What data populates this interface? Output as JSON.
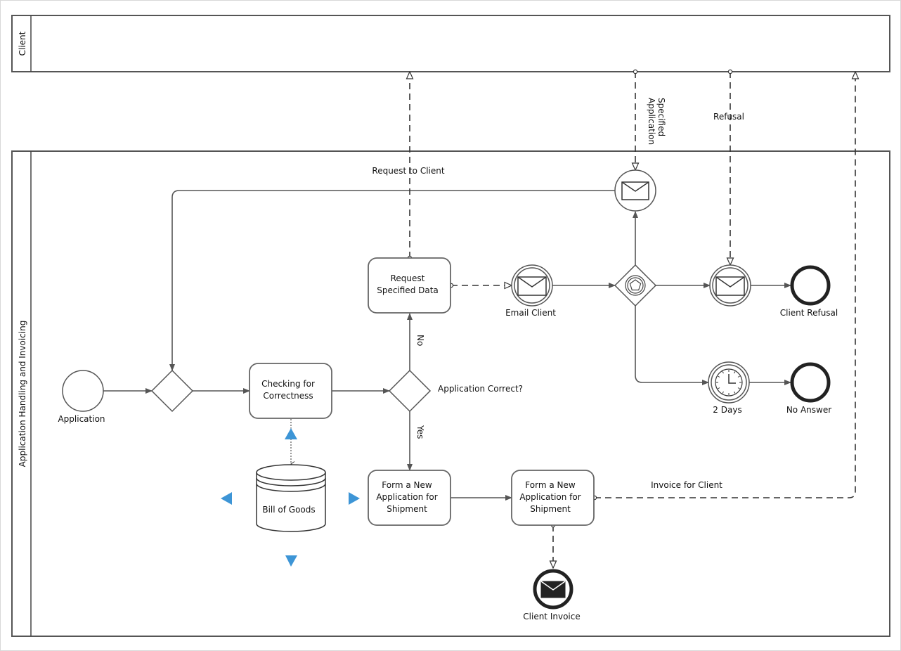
{
  "pools": {
    "client": {
      "label": "Client"
    },
    "main": {
      "label": "Application Handling and Invoicing"
    }
  },
  "nodes": {
    "start": {
      "label": "Application"
    },
    "gateway_merge": {
      "label": ""
    },
    "task_checking": {
      "label_lines": [
        "Checking for",
        "Correctness"
      ]
    },
    "gateway_correct": {
      "label": "Application Correct?"
    },
    "task_request": {
      "label_lines": [
        "Request",
        "Specified Data"
      ]
    },
    "event_email_client": {
      "label": "Email Client"
    },
    "gateway_event": {
      "label": ""
    },
    "event_receive_specified": {
      "label": ""
    },
    "event_receive_refusal": {
      "label": ""
    },
    "end_refusal": {
      "label": "Client Refusal"
    },
    "timer": {
      "label": "2 Days"
    },
    "end_no_answer": {
      "label": "No Answer"
    },
    "datastore": {
      "label": "Bill of Goods"
    },
    "task_form1": {
      "label_lines": [
        "Form a New",
        "Application for",
        "Shipment"
      ]
    },
    "task_form2": {
      "label_lines": [
        "Form a New",
        "Application for",
        "Shipment"
      ]
    },
    "end_invoice": {
      "label": "Client Invoice"
    }
  },
  "flows": {
    "no": "No",
    "yes": "Yes",
    "request_to_client": "Request to Client",
    "specified_application_lines": [
      "Specified",
      "Application"
    ],
    "refusal": "Refusal",
    "invoice_for_client": "Invoice for Client"
  },
  "colors": {
    "stroke": "#555555",
    "dark": "#222222",
    "handle": "#3d95d6"
  }
}
